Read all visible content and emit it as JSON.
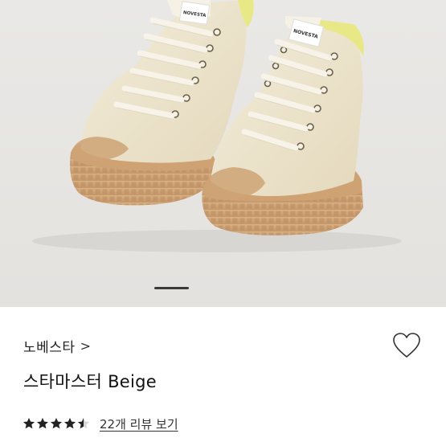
{
  "gallery": {
    "image_alt": "",
    "shoe_label": "NOVESTA",
    "active_page": 1,
    "colors": {
      "canvas": "#efe6cf",
      "sole": "#d3a979",
      "lining": "#e8e986",
      "background": "#e7e6e3"
    }
  },
  "product": {
    "brand": "노베스타",
    "brand_chevron": ">",
    "name": "스타마스터 Beige",
    "rating": 4.5,
    "rating_max": 5,
    "review_link": "22개 리뷰 보기"
  },
  "icons": {
    "wishlist": "heart-outline-icon",
    "star": "star-icon"
  }
}
